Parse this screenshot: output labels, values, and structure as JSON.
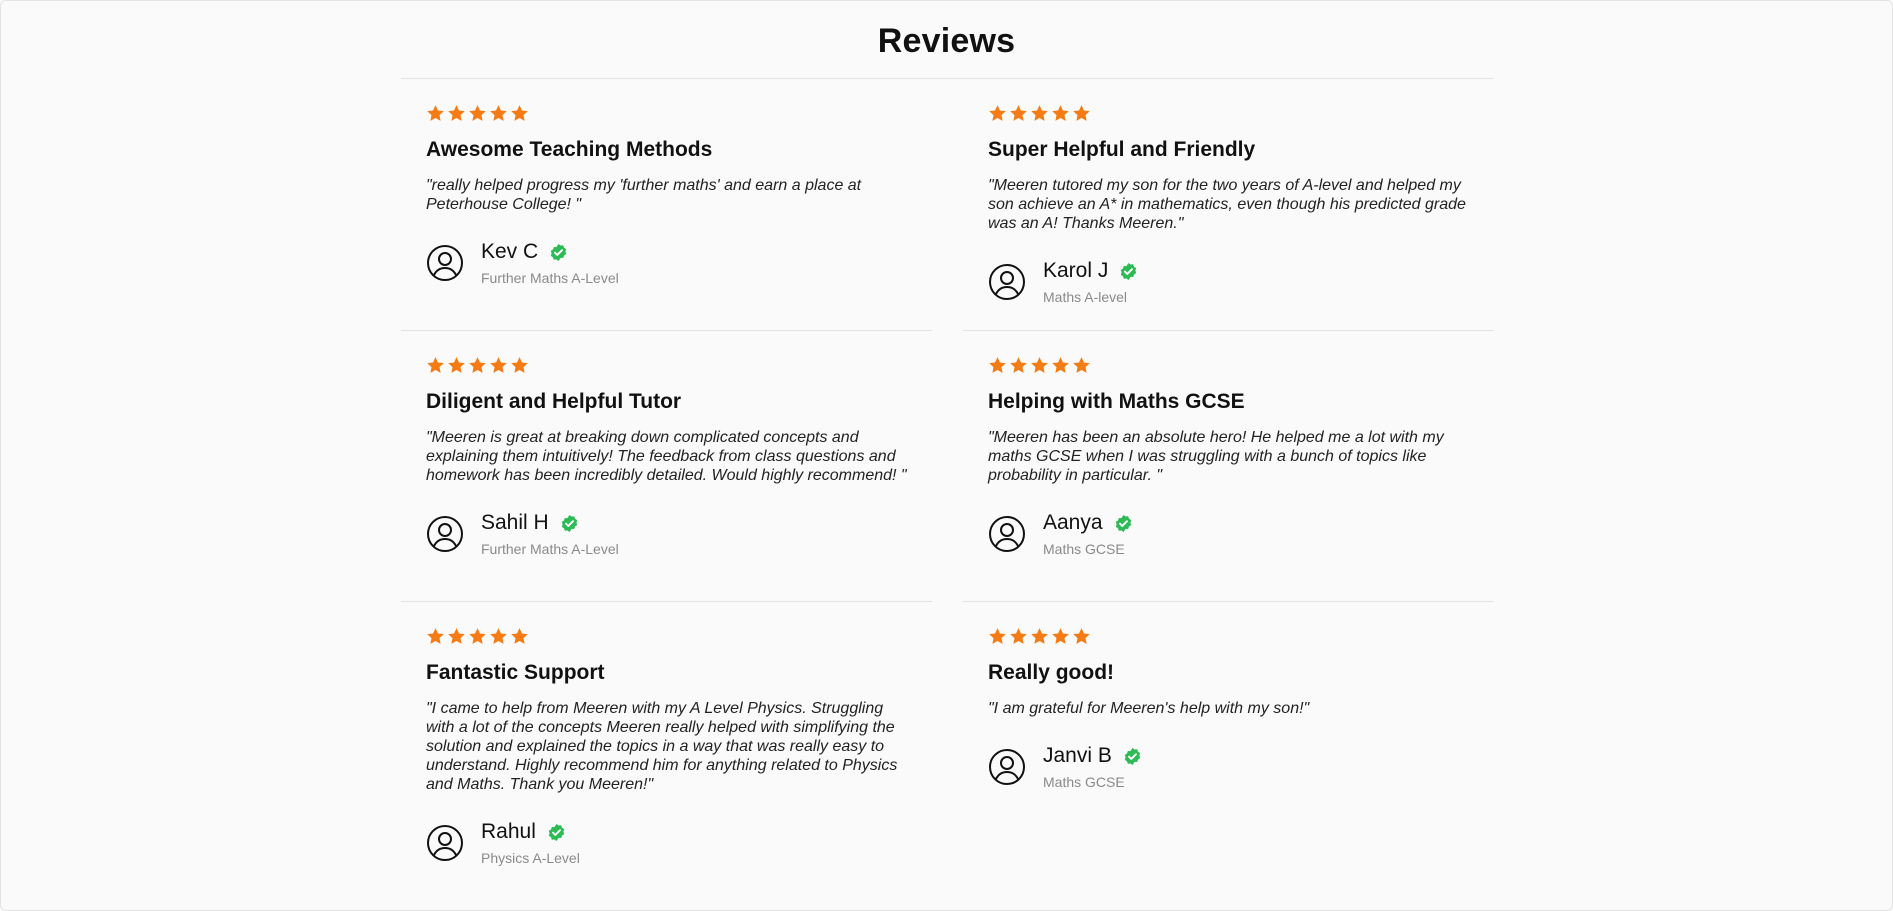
{
  "page": {
    "title": "Reviews"
  },
  "colors": {
    "star": "#f57c14",
    "verified": "#2dbb55",
    "divider": "#e2e2e2"
  },
  "icons": {
    "rating": "star-icon",
    "avatar": "user-circle-icon",
    "verified": "verified-check-icon"
  },
  "reviews_left": [
    {
      "rating": 5,
      "title": "Awesome Teaching Methods",
      "quote": "\"really helped progress my 'further maths' and earn a place at Peterhouse College! \"",
      "author": "Kev C",
      "course": "Further Maths A-Level"
    },
    {
      "rating": 5,
      "title": "Diligent and Helpful Tutor",
      "quote": "\"Meeren is great at breaking down complicated concepts and explaining them intuitively! The feedback from class questions and homework has been incredibly detailed. Would highly recommend! \"",
      "author": "Sahil H",
      "course": "Further Maths A-Level"
    },
    {
      "rating": 5,
      "title": "Fantastic Support",
      "quote": "\"I came to help from Meeren with my A Level Physics. Struggling with a lot of the concepts Meeren really helped with simplifying the solution and explained the topics in a way that was really easy to understand. Highly recommend him for anything related to Physics and Maths. Thank you Meeren!\"",
      "author": "Rahul",
      "course": "Physics A-Level"
    }
  ],
  "reviews_right": [
    {
      "rating": 5,
      "title": "Super Helpful and Friendly",
      "quote": "\"Meeren tutored my son for the two years of A-level and helped my son achieve an A* in mathematics, even though his predicted grade was an A! Thanks Meeren.\"",
      "author": "Karol J",
      "course": "Maths A-level"
    },
    {
      "rating": 5,
      "title": "Helping with Maths GCSE",
      "quote": "\"Meeren has been an absolute hero! He helped me a lot with my maths GCSE when I was struggling with a bunch of topics like probability in particular. \"",
      "author": "Aanya",
      "course": "Maths GCSE"
    },
    {
      "rating": 5,
      "title": "Really good!",
      "quote": "\"I am grateful for Meeren's help with my son!\"",
      "author": "Janvi B",
      "course": "Maths GCSE"
    }
  ]
}
